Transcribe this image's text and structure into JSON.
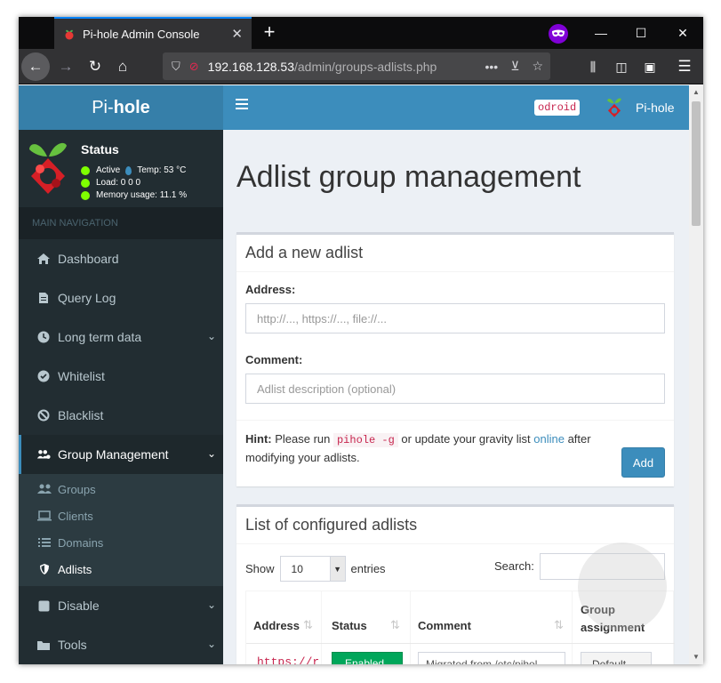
{
  "browser": {
    "tab_title": "Pi-hole Admin Console",
    "url_host": "192.168.128.53",
    "url_path": "/admin/groups-adlists.php"
  },
  "brand": {
    "prefix": "Pi-",
    "bold": "hole"
  },
  "header": {
    "hostname": "odroid",
    "user_label": "Pi-hole"
  },
  "status": {
    "title": "Status",
    "active_label": "Active",
    "temp_label": "Temp: 53 °C",
    "load_label": "Load:  0  0  0",
    "memory_label": "Memory usage:  11.1 %"
  },
  "sidebar": {
    "header": "MAIN NAVIGATION",
    "items": [
      {
        "label": "Dashboard",
        "icon": "home-icon"
      },
      {
        "label": "Query Log",
        "icon": "file-icon"
      },
      {
        "label": "Long term data",
        "icon": "clock-icon"
      },
      {
        "label": "Whitelist",
        "icon": "check-circle-icon"
      },
      {
        "label": "Blacklist",
        "icon": "ban-icon"
      },
      {
        "label": "Group Management",
        "icon": "users-cog-icon"
      },
      {
        "label": "Disable",
        "icon": "square-icon"
      },
      {
        "label": "Tools",
        "icon": "folder-icon"
      }
    ],
    "subitems": [
      {
        "label": "Groups",
        "icon": "user-friends-icon"
      },
      {
        "label": "Clients",
        "icon": "laptop-icon"
      },
      {
        "label": "Domains",
        "icon": "list-icon"
      },
      {
        "label": "Adlists",
        "icon": "shield-icon"
      }
    ]
  },
  "main": {
    "page_title": "Adlist group management",
    "add_box": {
      "title": "Add a new adlist",
      "address_label": "Address:",
      "address_placeholder": "http://..., https://..., file://...",
      "comment_label": "Comment:",
      "comment_placeholder": "Adlist description (optional)",
      "hint_bold": "Hint:",
      "hint_text_1": " Please run ",
      "hint_code": "pihole -g",
      "hint_text_2": " or update your gravity list ",
      "hint_link": "online",
      "hint_text_3": " after modifying your adlists.",
      "add_button": "Add"
    },
    "list_box": {
      "title": "List of configured adlists",
      "show_label": "Show",
      "entries_value": "10",
      "entries_label": "entries",
      "search_label": "Search:",
      "columns": [
        "Address",
        "Status",
        "Comment",
        "Group assignment"
      ],
      "row": {
        "address": "https://r",
        "status": "Enabled",
        "comment": "Migrated from /etc/pihol",
        "group": "Default"
      }
    }
  }
}
